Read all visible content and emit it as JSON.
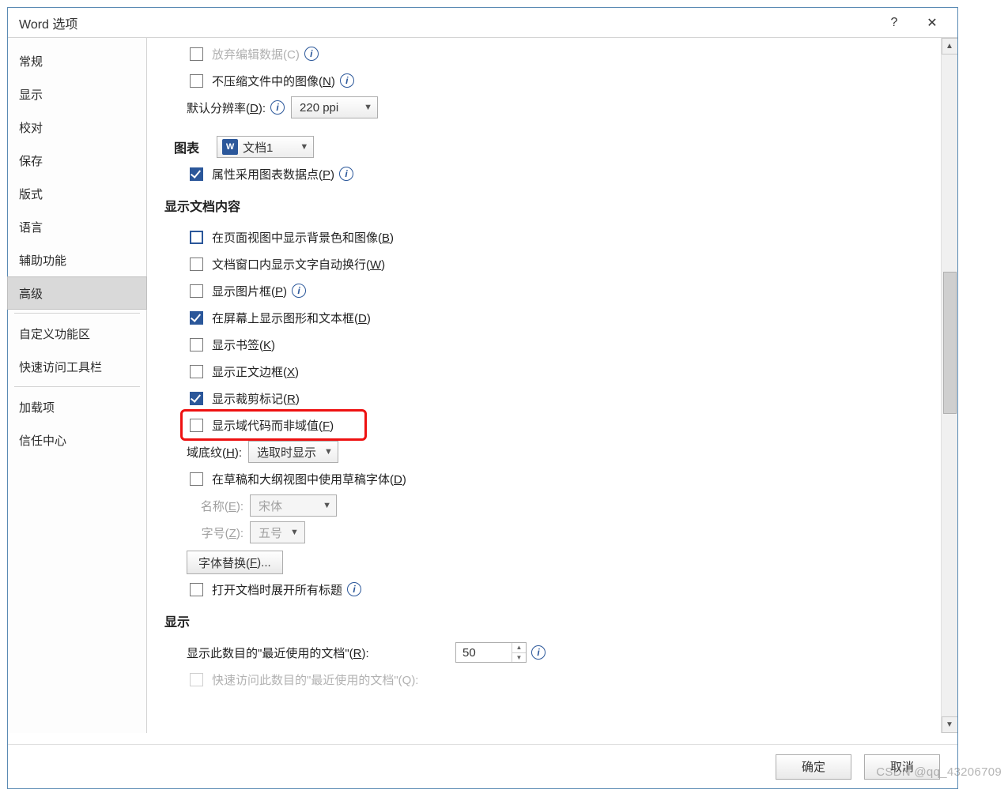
{
  "window": {
    "title": "Word 选项",
    "help": "?",
    "close": "✕"
  },
  "sidebar": {
    "items": [
      "常规",
      "显示",
      "校对",
      "保存",
      "版式",
      "语言",
      "辅助功能",
      "高级",
      "自定义功能区",
      "快速访问工具栏",
      "加载项",
      "信任中心"
    ],
    "selected_index": 7,
    "separators_after": [
      7,
      9
    ]
  },
  "top": {
    "cutoff_label": "放弃编辑数据(C)",
    "no_compress_label": "不压缩文件中的图像(",
    "no_compress_mn": "N",
    "no_compress_after": ")",
    "default_res_label": "默认分辨率(",
    "default_res_mn": "D",
    "default_res_after": "):",
    "default_res_value": "220 ppi"
  },
  "chart_section": {
    "label": "图表",
    "doc_dd_value": "文档1",
    "prop_label": "属性采用图表数据点(",
    "prop_mn": "P",
    "prop_after": ")"
  },
  "doc_content": {
    "title": "显示文档内容",
    "items": [
      {
        "pre": "在页面视图中显示背景色和图像(",
        "mn": "B",
        "post": ")",
        "checked": false,
        "blue": true
      },
      {
        "pre": "文档窗口内显示文字自动换行(",
        "mn": "W",
        "post": ")",
        "checked": false
      },
      {
        "pre": "显示图片框(",
        "mn": "P",
        "post": ")",
        "checked": false,
        "info": true
      },
      {
        "pre": "在屏幕上显示图形和文本框(",
        "mn": "D",
        "post": ")",
        "checked": true
      },
      {
        "pre": "显示书签(",
        "mn": "K",
        "post": ")",
        "checked": false
      },
      {
        "pre": "显示正文边框(",
        "mn": "X",
        "post": ")",
        "checked": false
      },
      {
        "pre": "显示裁剪标记(",
        "mn": "R",
        "post": ")",
        "checked": true
      },
      {
        "pre": "显示域代码而非域值(",
        "mn": "F",
        "post": ")",
        "checked": false,
        "highlight": true
      }
    ],
    "field_shading_label": "域底纹(",
    "field_shading_mn": "H",
    "field_shading_after": "):",
    "field_shading_value": "选取时显示",
    "draft_font_label": "在草稿和大纲视图中使用草稿字体(",
    "draft_font_mn": "D",
    "draft_font_after": ")",
    "name_label": "名称(",
    "name_mn": "E",
    "name_after": "):",
    "name_value": "宋体",
    "size_label": "字号(",
    "size_mn": "Z",
    "size_after": "):",
    "size_value": "五号",
    "font_sub_btn": "字体替换(",
    "font_sub_mn": "F",
    "font_sub_after": ")...",
    "expand_titles_label": "打开文档时展开所有标题"
  },
  "display_section": {
    "title": "显示",
    "recent_label": "显示此数目的\"最近使用的文档\"(",
    "recent_mn": "R",
    "recent_after": "):",
    "recent_value": "50",
    "cutoff2": "快速访问此数目的\"最近使用的文档\"(Q):"
  },
  "footer": {
    "ok": "确定",
    "cancel": "取消"
  },
  "watermark": "CSDN @qq_43206709"
}
